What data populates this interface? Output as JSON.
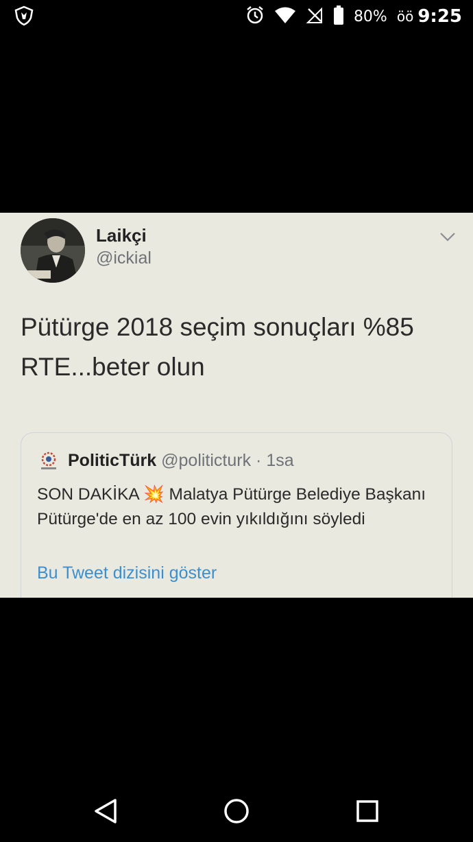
{
  "status_bar": {
    "battery": "80%",
    "ampm": "öö",
    "time": "9:25",
    "icons": [
      "shield-icon",
      "alarm-icon",
      "wifi-icon",
      "no-signal-icon",
      "battery-icon"
    ]
  },
  "tweet": {
    "display_name": "Laikçi",
    "handle": "@ickial",
    "text": "Pütürge 2018 seçim sonuçları %85 RTE...beter olun",
    "menu_icon": "chevron-down-icon",
    "quoted": {
      "name": "PoliticTürk",
      "meta": "@politicturk · 1sa",
      "text": "SON DAKİKA 💥 Malatya Pütürge Belediye Başkanı Pütürge'de en az 100 evin yıkıldığını söyledi",
      "link": "Bu Tweet dizisini göster"
    }
  },
  "nav_bar": {
    "icons": [
      "back-icon",
      "home-icon",
      "recents-icon"
    ]
  },
  "colors": {
    "card_bg": "#e9e9df",
    "link": "#3c8fcf",
    "secondary_text": "#6f7278"
  }
}
